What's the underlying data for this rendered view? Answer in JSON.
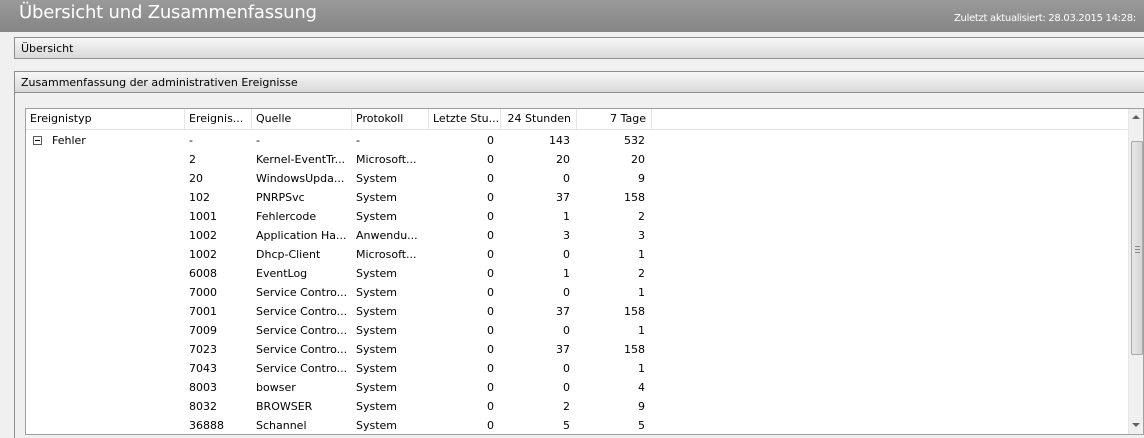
{
  "window": {
    "title": "Übersicht und Zusammenfassung",
    "last_updated": "Zuletzt aktualisiert: 28.03.2015 14:28:"
  },
  "sections": {
    "overview": "Übersicht",
    "summary": "Zusammenfassung der administrativen Ereignisse"
  },
  "table": {
    "columns": [
      "Ereignistyp",
      "Ereignis...",
      "Quelle",
      "Protokoll",
      "Letzte Stu...",
      "24 Stunden",
      "7 Tage"
    ],
    "group": {
      "label": "Fehler",
      "expander": "minus-box-icon",
      "id": "-",
      "source": "-",
      "log": "-",
      "last_hour": "0",
      "day": "143",
      "week": "532"
    },
    "rows": [
      [
        "2",
        "Kernel-EventTr...",
        "Microsoft...",
        "0",
        "20",
        "20"
      ],
      [
        "20",
        "WindowsUpda...",
        "System",
        "0",
        "0",
        "9"
      ],
      [
        "102",
        "PNRPSvc",
        "System",
        "0",
        "37",
        "158"
      ],
      [
        "1001",
        "Fehlercode",
        "System",
        "0",
        "1",
        "2"
      ],
      [
        "1002",
        "Application Ha...",
        "Anwendu...",
        "0",
        "3",
        "3"
      ],
      [
        "1002",
        "Dhcp-Client",
        "Microsoft...",
        "0",
        "0",
        "1"
      ],
      [
        "6008",
        "EventLog",
        "System",
        "0",
        "1",
        "2"
      ],
      [
        "7000",
        "Service Contro...",
        "System",
        "0",
        "0",
        "1"
      ],
      [
        "7001",
        "Service Contro...",
        "System",
        "0",
        "37",
        "158"
      ],
      [
        "7009",
        "Service Contro...",
        "System",
        "0",
        "0",
        "1"
      ],
      [
        "7023",
        "Service Contro...",
        "System",
        "0",
        "37",
        "158"
      ],
      [
        "7043",
        "Service Contro...",
        "System",
        "0",
        "0",
        "1"
      ],
      [
        "8003",
        "bowser",
        "System",
        "0",
        "0",
        "4"
      ],
      [
        "8032",
        "BROWSER",
        "System",
        "0",
        "2",
        "9"
      ],
      [
        "36888",
        "Schannel",
        "System",
        "0",
        "5",
        "5"
      ]
    ]
  },
  "scrollbar": {
    "up": "scroll-up-icon",
    "down": "scroll-down-icon"
  }
}
